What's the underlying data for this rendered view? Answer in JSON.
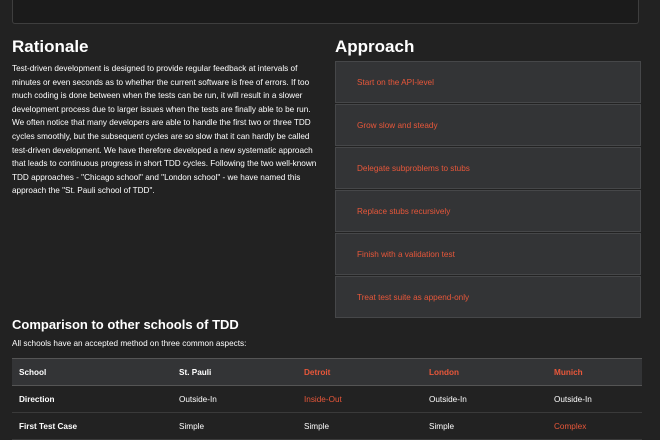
{
  "rationale": {
    "title": "Rationale",
    "body": "Test-driven development is designed to provide regular feedback at intervals of minutes or even seconds as to whether the current software is free of errors. If too much coding is done between when the tests can be run, it will result in a slower development process due to larger issues when the tests are finally able to be run. We often notice that many developers are able to handle the first two or three TDD cycles smoothly, but the subsequent cycles are so slow that it can hardly be called test-driven development. We have therefore developed a new systematic approach that leads to continuous progress in short TDD cycles. Following the two well-known TDD approaches - \"Chicago school\" and \"London school\" - we have named this approach the \"St. Pauli school of TDD\"."
  },
  "approach": {
    "title": "Approach",
    "steps": [
      "Start on the API-level",
      "Grow slow and steady",
      "Delegate subproblems to stubs",
      "Replace stubs recursively",
      "Finish with a validation test",
      "Treat test suite as append-only"
    ]
  },
  "comparison": {
    "title": "Comparison to other schools of TDD",
    "intro": "All schools have an accepted method on three common aspects:",
    "headers": [
      "School",
      "St. Pauli",
      "Detroit",
      "London",
      "Munich"
    ],
    "rows": [
      [
        "Direction",
        "Outside-In",
        "Inside-Out",
        "Outside-In",
        "Outside-In"
      ],
      [
        "First Test Case",
        "Simple",
        "Simple",
        "Simple",
        "Complex"
      ]
    ]
  },
  "colors": {
    "accent": "#e8573a",
    "background": "#222222",
    "panel": "#333436"
  }
}
